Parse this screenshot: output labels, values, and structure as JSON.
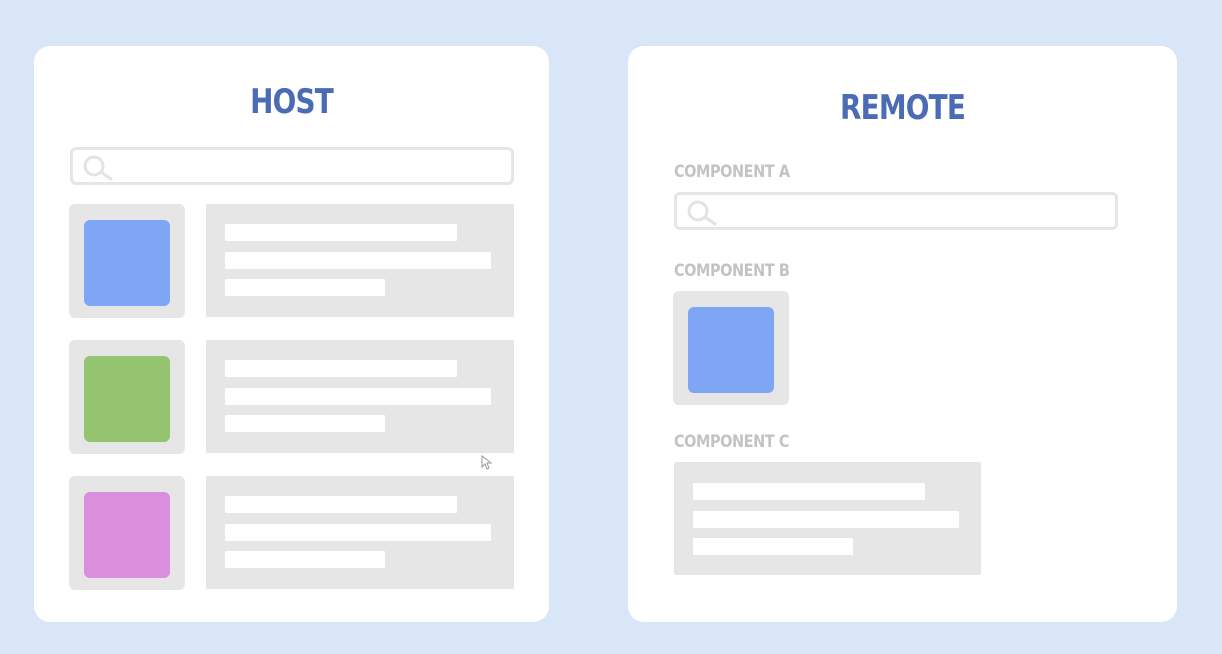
{
  "host": {
    "title": "HOST",
    "rows": [
      {
        "color": "#7ea6f4"
      },
      {
        "color": "#95c470"
      },
      {
        "color": "#db8edb"
      }
    ]
  },
  "remote": {
    "title": "REMOTE",
    "component_a_label": "COMPONENT A",
    "component_b_label": "COMPONENT B",
    "component_c_label": "COMPONENT C",
    "component_b_color": "#7ea6f4"
  },
  "colors": {
    "background": "#d9e6f8",
    "title": "#4b6bb5",
    "placeholder_gray": "#e6e6e6"
  },
  "icons": [
    "search-icon",
    "mouse-cursor-icon"
  ]
}
